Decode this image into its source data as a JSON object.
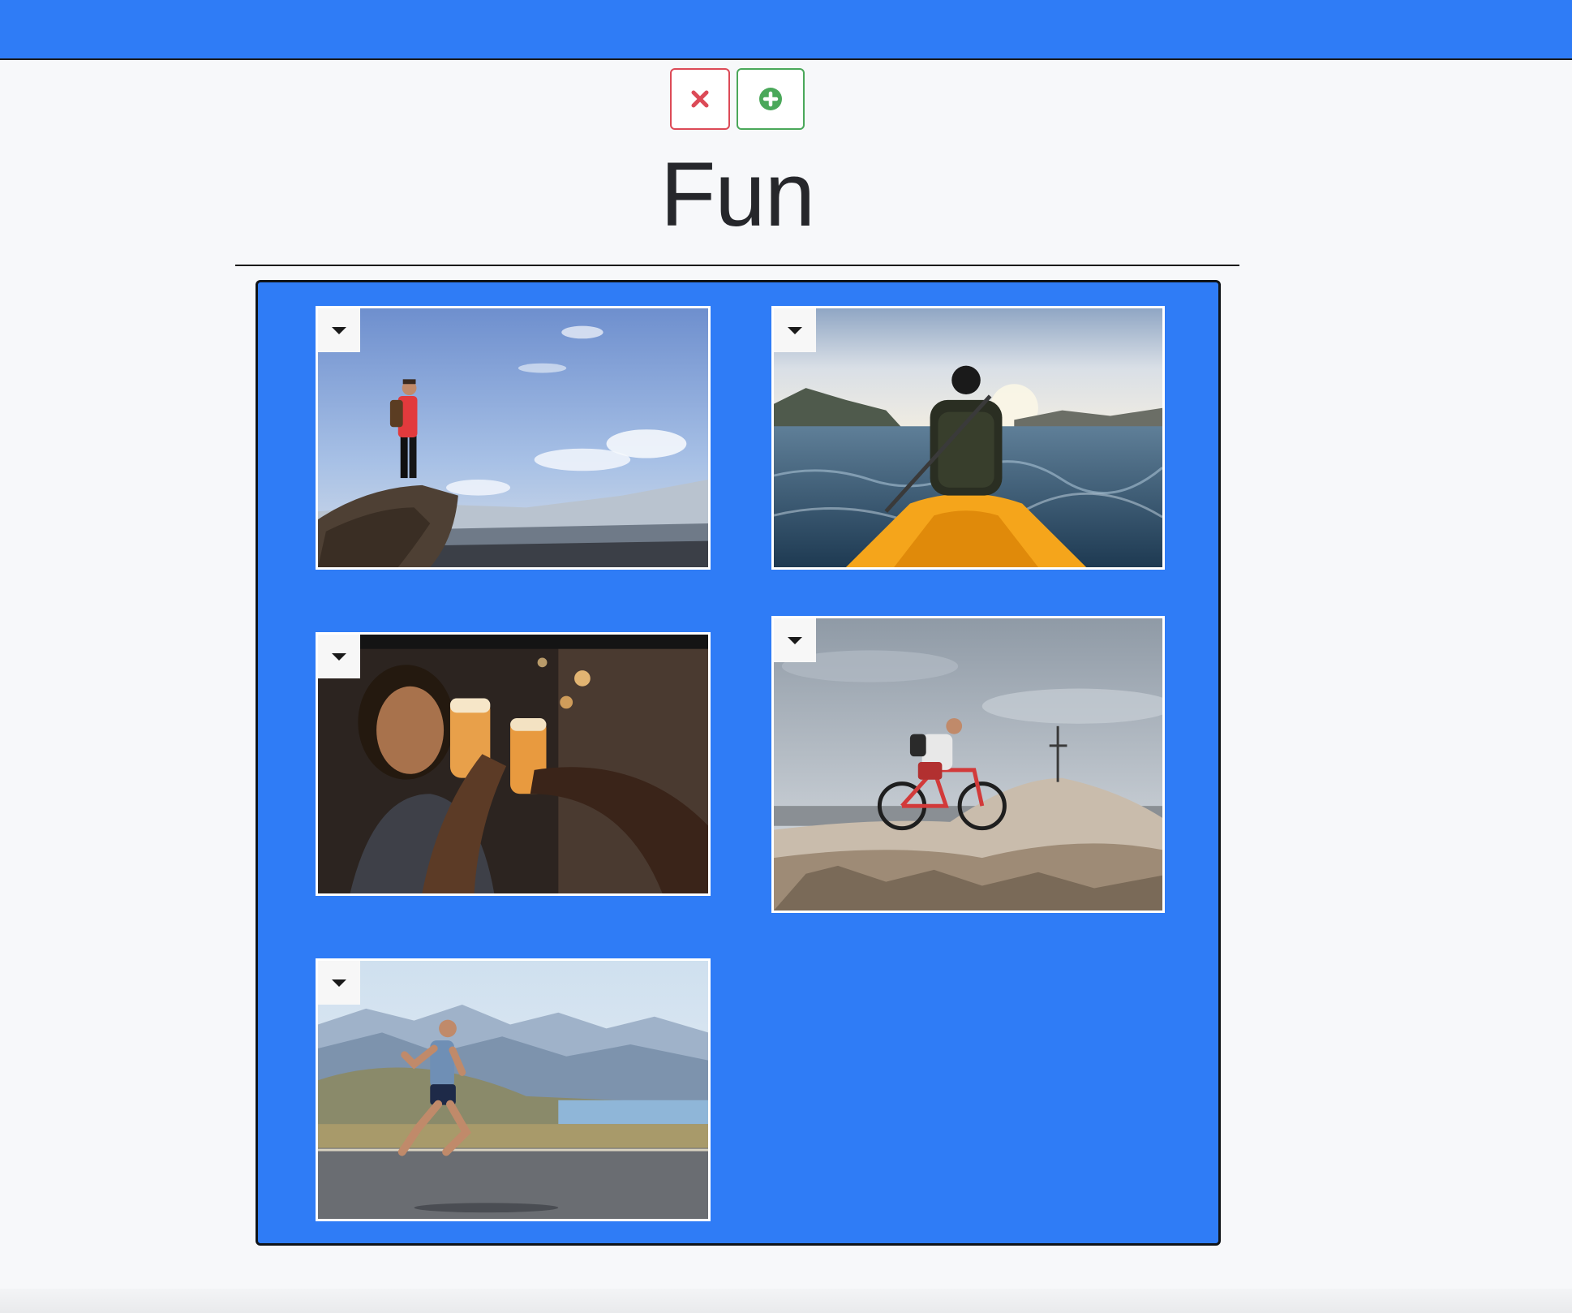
{
  "header": {
    "background_color": "#2f7cf6"
  },
  "toolbar": {
    "delete_icon": "close-icon",
    "delete_color": "#dc4a57",
    "add_icon": "plus-circle-icon",
    "add_color": "#4aa85a"
  },
  "album": {
    "title": "Fun",
    "panel_color": "#2f7cf6",
    "photos": [
      {
        "subject": "hiker-on-cliff"
      },
      {
        "subject": "kayaker-on-sea"
      },
      {
        "subject": "friends-toasting-beer"
      },
      {
        "subject": "mountain-biker-on-summit"
      },
      {
        "subject": "runner-on-road"
      }
    ]
  }
}
